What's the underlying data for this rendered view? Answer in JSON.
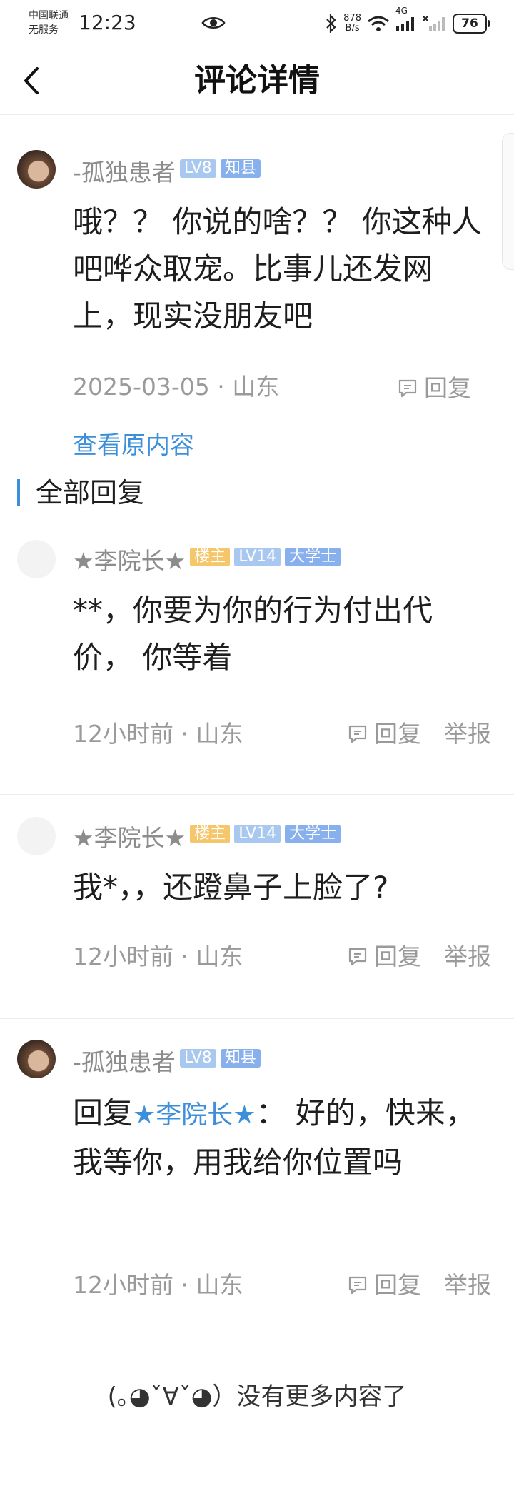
{
  "status_bar": {
    "carrier_line1": "中国联通",
    "carrier_line2": "无服务",
    "time": "12:23",
    "net_speed_value": "878",
    "net_speed_unit": "B/s",
    "network_type": "4G",
    "battery": "76"
  },
  "header": {
    "title": "评论详情"
  },
  "main_comment": {
    "username": "-孤独患者",
    "level_badge": "LV8",
    "tag_badge": "知县",
    "content": "哦？？ 你说的啥？？ 你这种人吧哗众取宠。比事儿还发网上，现实没朋友吧",
    "date": "2025-03-05",
    "separator": "·",
    "location": "山东",
    "reply_label": "回复",
    "view_original": "查看原内容"
  },
  "section": {
    "title": "全部回复"
  },
  "replies": [
    {
      "username": "★李院长★",
      "host_badge": "楼主",
      "level_badge": "LV14",
      "tag_badge": "大学士",
      "content": "**，你要为你的行为付出代价， 你等着",
      "time": "12小时前",
      "location": "山东",
      "reply_label": "回复",
      "report_label": "举报"
    },
    {
      "username": "★李院长★",
      "host_badge": "楼主",
      "level_badge": "LV14",
      "tag_badge": "大学士",
      "content": "我*，，还蹬鼻子上脸了?",
      "time": "12小时前",
      "location": "山东",
      "reply_label": "回复",
      "report_label": "举报"
    },
    {
      "username": "-孤独患者",
      "level_badge": "LV8",
      "tag_badge": "知县",
      "reply_prefix": "回复",
      "mention": "★李院长★",
      "content_after": "： 好的，快来，我等你，用我给你位置吗",
      "time": "12小时前",
      "location": "山东",
      "reply_label": "回复",
      "report_label": "举报"
    }
  ],
  "footer": {
    "end_note": "(｡◕ˇ∀ˇ◕）没有更多内容了"
  },
  "colors": {
    "link": "#3e8fd9",
    "meta_gray": "#9a9a9a",
    "host_badge": "#f6c66b",
    "level_badge": "#a9c8ef"
  }
}
